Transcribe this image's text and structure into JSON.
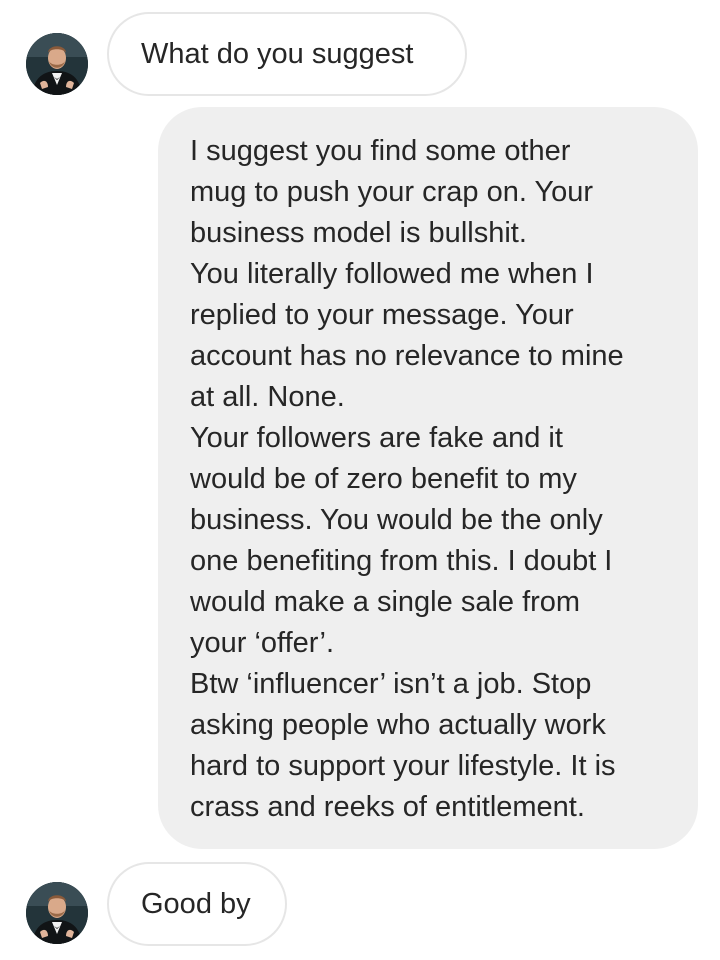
{
  "messages": [
    {
      "sender": "other",
      "type": "outline",
      "text": "What do you suggest"
    },
    {
      "sender": "me",
      "type": "filled",
      "paragraphs": [
        "I suggest you find some other\nmug to push your crap on. Your\nbusiness model is bullshit.",
        "You literally followed me when I\nreplied to your message. Your\naccount has no relevance to mine\nat all. None.",
        "Your followers are fake and it\nwould be of zero benefit to my\nbusiness. You would be the only\none benefiting from this. I doubt I\nwould make a single sale from\nyour ‘offer’.",
        "Btw ‘influencer’ isn’t a job. Stop\nasking people who actually work\nhard to support your lifestyle. It is\ncrass and reeks of entitlement."
      ]
    },
    {
      "sender": "other",
      "type": "outline",
      "text": "Good by"
    }
  ],
  "colors": {
    "text": "#262626",
    "filled_bubble_bg": "#efefef",
    "outline_bubble_border": "#e6e6e6",
    "background": "#ffffff"
  },
  "icons": {
    "avatar": "profile-photo-avatar"
  }
}
